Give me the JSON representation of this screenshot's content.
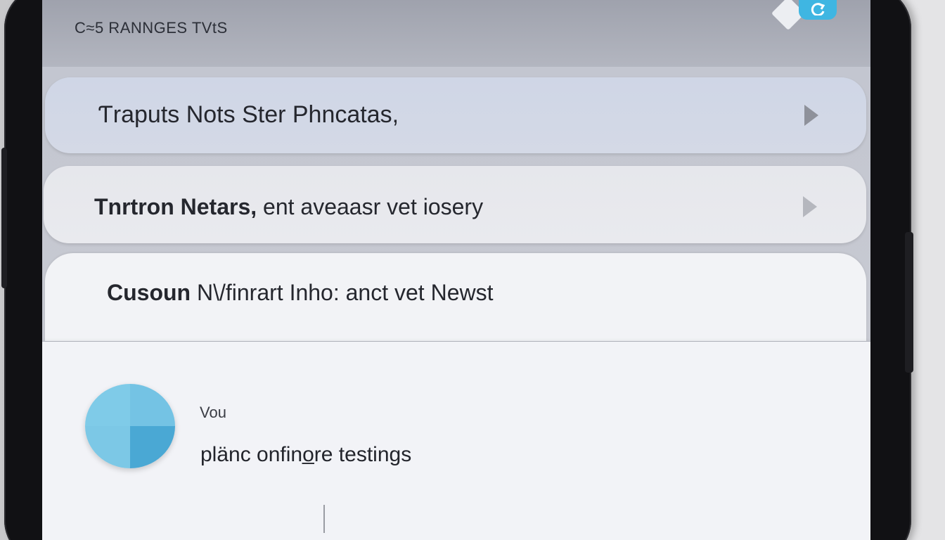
{
  "header": {
    "title": "C≈5 RANNGES TVtS",
    "refresh_icon": "refresh-icon",
    "accent": "#3fb6e2"
  },
  "list": {
    "items": [
      {
        "bold": "",
        "text": "Ƭraputs Nots Ster Phncatas,",
        "icon": "chevron-right-icon"
      },
      {
        "bold": "Tnrtron Netars,",
        "text": " ent aveaasr vet iosery",
        "icon": "chevron-right-icon"
      },
      {
        "bold": "Cusoun",
        "text": " N\\/finrart Inho: anct vet Newst",
        "icon": ""
      }
    ]
  },
  "profile": {
    "label": "Vou",
    "status": "plänc onfino̲re testings",
    "avatar_icon": "avatar-icon"
  }
}
